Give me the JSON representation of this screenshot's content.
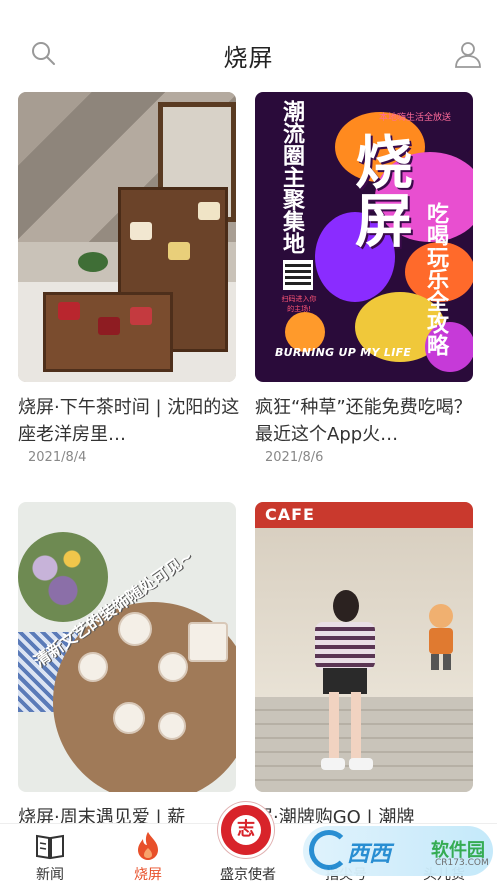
{
  "header": {
    "title": "烧屏",
    "search_icon": "search-icon",
    "user_icon": "user-icon"
  },
  "cards": [
    {
      "title": "烧屏·下午茶时间 | 沈阳的这座老洋房里…",
      "date": "2021/8/4",
      "image": "afternoon-tea-photo"
    },
    {
      "title": "疯狂“种草”还能免费吃喝？最近这个App火…",
      "date": "2021/8/6",
      "image": "poster-image",
      "poster": {
        "vertical_left": "潮流圈主聚集地",
        "big": "烧屏",
        "vertical_right": "吃喝玩乐全攻略",
        "tag": "本地嗨生活全放送",
        "qr_text": "扫码进入你的主场!",
        "english": "BURNING UP MY LIFE"
      }
    },
    {
      "title": "烧屏·周末遇见爱 | 薪",
      "date": "",
      "image": "flatlay-photo",
      "overlay": "清新文艺的装饰随处可见~"
    },
    {
      "title": "屏·潮牌购GO | 潮牌",
      "date": "",
      "image": "storefront-photo",
      "sign": "CAFE"
    }
  ],
  "tabbar": {
    "items": [
      {
        "label": "新闻",
        "icon": "book-icon",
        "active": false
      },
      {
        "label": "烧屏",
        "icon": "flame-icon",
        "active": true
      },
      {
        "label": "盛京使者",
        "icon": "emblem-icon",
        "active": false
      },
      {
        "label": "指尖号",
        "icon": "finger-icon",
        "active": false
      },
      {
        "label": "头儿货",
        "icon": "bag-icon",
        "active": false
      }
    ]
  },
  "watermark": {
    "name": "西西",
    "sub": "软件园",
    "url": "CR173.COM"
  },
  "colors": {
    "accent": "#e8502a",
    "poster_bg": "#2a0b3a",
    "emblem": "#d8232a"
  }
}
